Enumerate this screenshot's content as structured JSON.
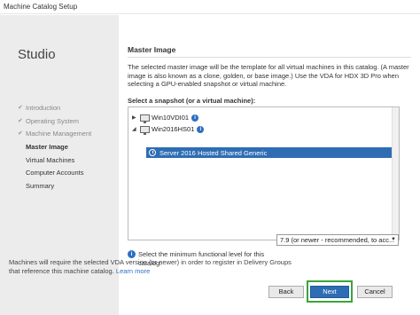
{
  "window": {
    "title": "Machine Catalog Setup"
  },
  "sidebar": {
    "app_name": "Studio",
    "items": [
      {
        "label": "Introduction",
        "state": "done"
      },
      {
        "label": "Operating System",
        "state": "done"
      },
      {
        "label": "Machine Management",
        "state": "done"
      },
      {
        "label": "Master Image",
        "state": "current"
      },
      {
        "label": "Virtual Machines",
        "state": "pending"
      },
      {
        "label": "Computer Accounts",
        "state": "pending"
      },
      {
        "label": "Summary",
        "state": "pending"
      }
    ]
  },
  "main": {
    "title": "Master Image",
    "description": "The selected master image will be the template for all virtual machines in this catalog. (A master image is also known as a clone, golden, or base image.) Use the VDA for HDX 3D Pro when selecting a GPU-enabled snapshot or virtual machine.",
    "select_label": "Select a snapshot (or a virtual machine):",
    "tree": [
      {
        "label": "Win10VDI01",
        "expanded": false
      },
      {
        "label": "Win2016HS01",
        "expanded": true,
        "children": [
          {
            "label": "Server 2016 Hosted Shared Generic",
            "selected": true
          }
        ]
      }
    ],
    "functional_level_label": "Select the minimum functional level for this catalog:",
    "functional_level_value": "7.9 (or newer - recommended, to acc...",
    "note_text": "Machines will require the selected VDA version (or newer) in order to register in Delivery Groups that reference this machine catalog. ",
    "note_link": "Learn more"
  },
  "buttons": {
    "back": "Back",
    "next": "Next",
    "cancel": "Cancel"
  },
  "colors": {
    "accent": "#2e6db4",
    "highlight": "#3aa33a",
    "sidebar_bg": "#ececec"
  }
}
